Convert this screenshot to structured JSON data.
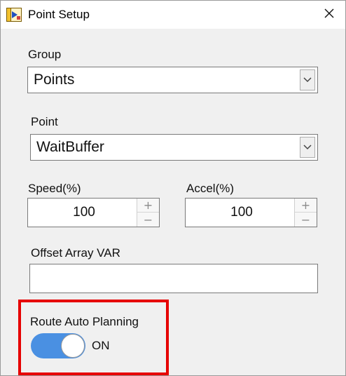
{
  "window": {
    "title": "Point Setup",
    "app_icon": "labview-vi-icon",
    "close_icon": "close-icon"
  },
  "group": {
    "label": "Group",
    "selected": "Points"
  },
  "point": {
    "label": "Point",
    "selected": "WaitBuffer"
  },
  "speed": {
    "label": "Speed(%)",
    "value": "100",
    "increment": "+",
    "decrement": "−"
  },
  "accel": {
    "label": "Accel(%)",
    "value": "100",
    "increment": "+",
    "decrement": "−"
  },
  "offset_array": {
    "label": "Offset Array VAR",
    "value": ""
  },
  "route_auto_planning": {
    "label": "Route Auto Planning",
    "state_text": "ON",
    "on": true
  },
  "colors": {
    "toggle_on": "#4a90e2",
    "highlight_border": "#e60000",
    "window_bg": "#f0f0f0"
  }
}
